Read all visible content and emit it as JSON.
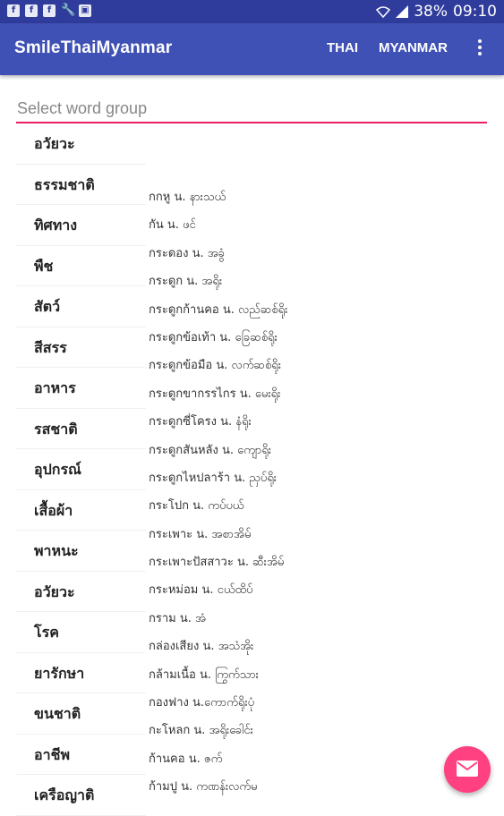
{
  "status_bar": {
    "icons": [
      "facebook-icon",
      "facebook-icon",
      "facebook-icon",
      "wrench-icon",
      "gallery-icon",
      "wifi-icon",
      "signal-icon"
    ],
    "battery": "38%",
    "time": "09:10"
  },
  "app_bar": {
    "title": "SmileThaiMyanmar",
    "menu": [
      "THAI",
      "MYANMAR"
    ],
    "overflow_icon": "more-vert-icon"
  },
  "selector": {
    "placeholder": "Select word group"
  },
  "categories": [
    "อวัยวะ",
    "ธรรมชาติ",
    "ทิศทาง",
    "พืช",
    "สัตว์",
    "สีสรร",
    "อาหาร",
    "รสชาติ",
    "อุปกรณ์",
    "เสื้อผ้า",
    "พาหนะ",
    "อวัยวะ",
    "โรค",
    "ยารักษา",
    "ขนชาติ",
    "อาชีพ",
    "เครือญาติ"
  ],
  "words": [
    "กกหู น. နားသယ်",
    "กัน น. ဖင်",
    "กระดอง น. အခွံ",
    "กระดูก น. အရိုး",
    "กระดูกก้านคอ น. လည်ဆစ်ရိုး",
    "กระดูกข้อเท้า น. ခြေဆစ်ရိုး",
    "กระดูกข้อมือ น. လက်ဆစ်ရိုး",
    "กระดูกขากรรไกร น. မေးရိုး",
    "กระดูกซี่โครง น. နံရိုး",
    "กระดูกสันหลัง น. ကျောရိုး",
    "กระดูกไหปลาร้า น. ညှပ်ရိုး",
    "กระโปก น. ကပ်ပယ်",
    "กระเพาะ น. အစာအိမ်",
    "กระเพาะปัสสาวะ น. ဆီးအိမ်",
    "กระหม่อม น. ငယ်ထိပ်",
    "กราม น. အံ",
    "กล่องเสียง น. အသံအိုး",
    "กล้ามเนื้อ น. ကြွက်သား",
    "กองฟาง น.ကောက်ရိုးပုံ",
    "กะโหลก น. အရိုးခေါင်း",
    "ก้านคอ น. ဇက်",
    "ก้ามปู น. ကဏန်းလက်မ"
  ],
  "fab": {
    "icon": "mail-icon"
  },
  "colors": {
    "status_bar": "#2f3c9c",
    "app_bar": "#3f51b5",
    "accent": "#e91e63",
    "fab": "#ff4081"
  }
}
